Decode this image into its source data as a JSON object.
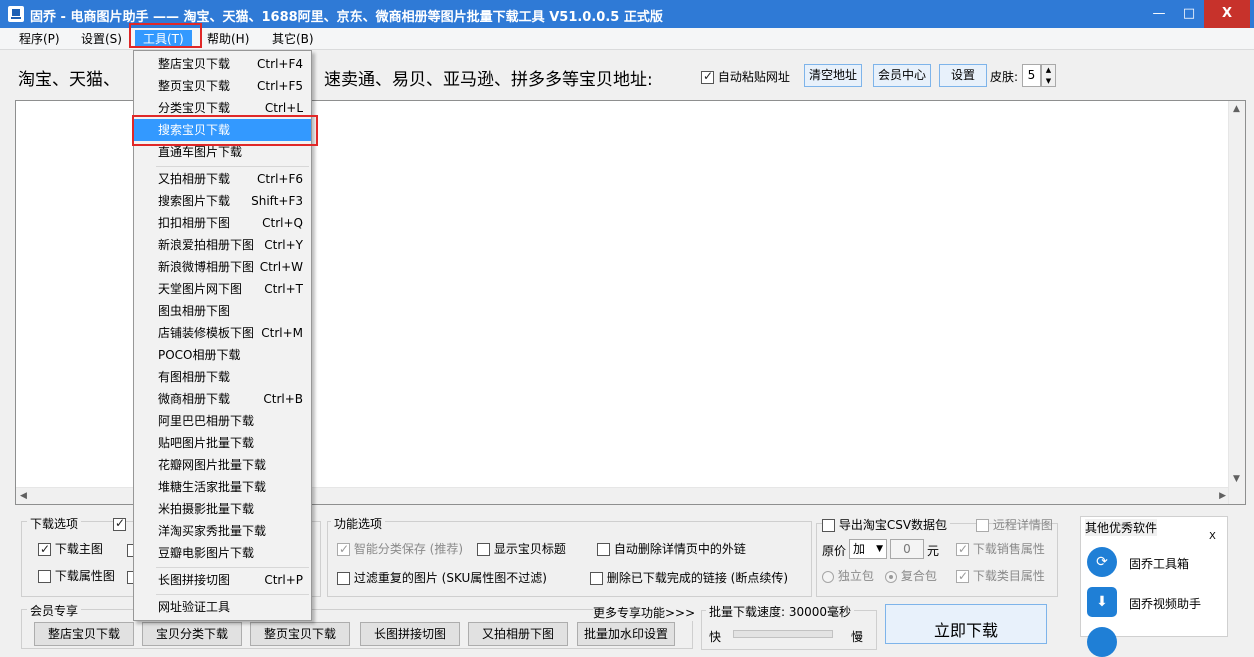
{
  "window": {
    "title": "固乔 - 电商图片助手 —— 淘宝、天猫、1688阿里、京东、微商相册等图片批量下载工具 V51.0.0.5 正式版",
    "minimize": "—",
    "maximize": "□",
    "close": "X"
  },
  "menubar": [
    {
      "label": "程序(P)"
    },
    {
      "label": "设置(S)"
    },
    {
      "label": "工具(T)"
    },
    {
      "label": "帮助(H)"
    },
    {
      "label": "其它(B)"
    }
  ],
  "toolbar": {
    "prompt_left": "淘宝、天猫、",
    "prompt_right": "速卖通、易贝、亚马逊、拼多多等宝贝地址:",
    "auto_paste": "自动粘贴网址",
    "clear_button": "清空地址",
    "member_button": "会员中心",
    "settings_button": "设置",
    "skin_label": "皮肤:",
    "skin_value": "5"
  },
  "tools_menu": {
    "items": [
      {
        "label": "整店宝贝下载",
        "shortcut": "Ctrl+F4"
      },
      {
        "label": "整页宝贝下载",
        "shortcut": "Ctrl+F5"
      },
      {
        "label": "分类宝贝下载",
        "shortcut": "Ctrl+L"
      },
      {
        "label": "搜索宝贝下载",
        "shortcut": ""
      },
      {
        "label": "直通车图片下载",
        "shortcut": ""
      },
      {
        "label": "又拍相册下载",
        "shortcut": "Ctrl+F6"
      },
      {
        "label": "搜索图片下载",
        "shortcut": "Shift+F3"
      },
      {
        "label": "扣扣相册下图",
        "shortcut": "Ctrl+Q"
      },
      {
        "label": "新浪爱拍相册下图",
        "shortcut": "Ctrl+Y"
      },
      {
        "label": "新浪微博相册下图",
        "shortcut": "Ctrl+W"
      },
      {
        "label": "天堂图片网下图",
        "shortcut": "Ctrl+T"
      },
      {
        "label": "图虫相册下图",
        "shortcut": ""
      },
      {
        "label": "店铺装修模板下图",
        "shortcut": "Ctrl+M"
      },
      {
        "label": "POCO相册下载",
        "shortcut": ""
      },
      {
        "label": "有图相册下载",
        "shortcut": ""
      },
      {
        "label": "微商相册下载",
        "shortcut": "Ctrl+B"
      },
      {
        "label": "阿里巴巴相册下载",
        "shortcut": ""
      },
      {
        "label": "贴吧图片批量下载",
        "shortcut": ""
      },
      {
        "label": "花瓣网图片批量下载",
        "shortcut": ""
      },
      {
        "label": "堆糖生活家批量下载",
        "shortcut": ""
      },
      {
        "label": "米拍摄影批量下载",
        "shortcut": ""
      },
      {
        "label": "洋淘买家秀批量下载",
        "shortcut": ""
      },
      {
        "label": "豆瓣电影图片下载",
        "shortcut": ""
      },
      {
        "label": "长图拼接切图",
        "shortcut": "Ctrl+P"
      },
      {
        "label": "网址验证工具",
        "shortcut": ""
      }
    ]
  },
  "download_options": {
    "title": "下载选项",
    "main_image": "下载主图",
    "attr_image": "下载属性图"
  },
  "feature_options": {
    "title": "功能选项",
    "smart_save": "智能分类保存 (推荐)",
    "show_title": "显示宝贝标题",
    "auto_delete_links": "自动删除详情页中的外链",
    "filter_duplicates": "过滤重复的图片 (SKU属性图不过滤)",
    "delete_done_links": "删除已下载完成的链接 (断点续传)"
  },
  "csv_options": {
    "export_csv": "导出淘宝CSV数据包",
    "remote_detail": "远程详情图",
    "price_label": "原价",
    "price_op": "加",
    "price_value": "0",
    "price_unit": "元",
    "download_sales_attr": "下载销售属性",
    "standalone_pack": "独立包",
    "compound_pack": "复合包",
    "download_category_attr": "下载类目属性"
  },
  "member_exclusive": {
    "title": "会员专享",
    "more": "更多专享功能>>>",
    "buttons": [
      "整店宝贝下载",
      "宝贝分类下载",
      "整页宝贝下载",
      "长图拼接切图",
      "又拍相册下图",
      "批量加水印设置"
    ]
  },
  "speed": {
    "label": "批量下载速度: 30000毫秒",
    "fast": "快",
    "slow": "慢"
  },
  "download_now": "立即下载",
  "side_panel": {
    "title": "其他优秀软件",
    "close": "X",
    "items": [
      {
        "label": "固乔工具箱",
        "icon": "toolbox-icon"
      },
      {
        "label": "固乔视频助手",
        "icon": "video-download-icon"
      }
    ]
  }
}
